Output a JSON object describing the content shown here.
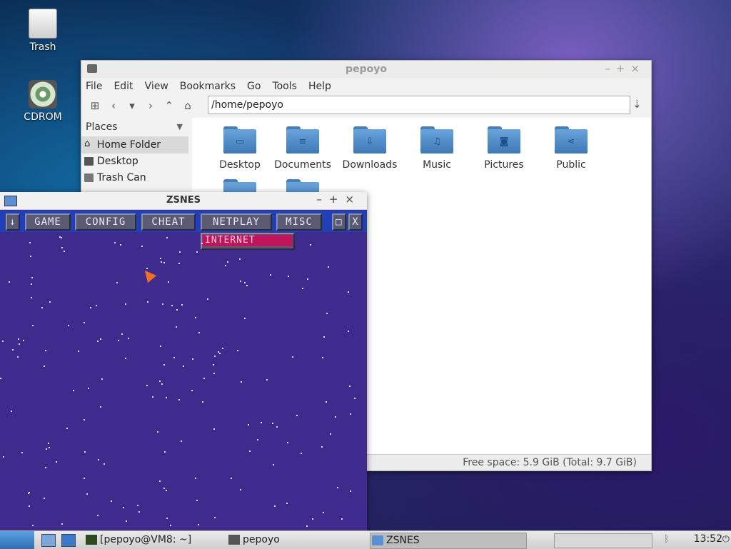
{
  "desktop": {
    "icons": [
      {
        "label": "Trash",
        "icon": "trash-icon"
      },
      {
        "label": "CDROM",
        "icon": "cdrom-icon"
      }
    ]
  },
  "file_manager": {
    "title": "pepoyo",
    "menu": [
      "File",
      "Edit",
      "View",
      "Bookmarks",
      "Go",
      "Tools",
      "Help"
    ],
    "address": "/home/pepoyo",
    "places_header": "Places",
    "places": [
      {
        "label": "Home Folder",
        "icon": "home-icon",
        "selected": true
      },
      {
        "label": "Desktop",
        "icon": "desktop-icon"
      },
      {
        "label": "Trash Can",
        "icon": "trash-icon"
      }
    ],
    "folders": [
      {
        "label": "Desktop",
        "glyph": "▭"
      },
      {
        "label": "Documents",
        "glyph": "≡"
      },
      {
        "label": "Downloads",
        "glyph": "⇩"
      },
      {
        "label": "Music",
        "glyph": "♫"
      },
      {
        "label": "Pictures",
        "glyph": "◙"
      },
      {
        "label": "Public",
        "glyph": "⋖"
      }
    ],
    "status": "Free space: 5.9 GiB (Total: 9.7 GiB)"
  },
  "zsnes": {
    "title": "ZSNES",
    "menu": [
      "GAME",
      "CONFIG",
      "CHEAT",
      "NETPLAY",
      "MISC"
    ],
    "arrow_label": "↓",
    "min_label": "□",
    "close_label": "X",
    "dropdown": [
      "INTERNET"
    ],
    "colors": {
      "bg": "#3f2b8d",
      "bar": "#2140b8",
      "highlight": "#c0145c"
    }
  },
  "taskbar": {
    "tasks": [
      "[pepoyo@VM8: ~]",
      "pepoyo",
      "ZSNES"
    ],
    "clock": "13:52"
  }
}
